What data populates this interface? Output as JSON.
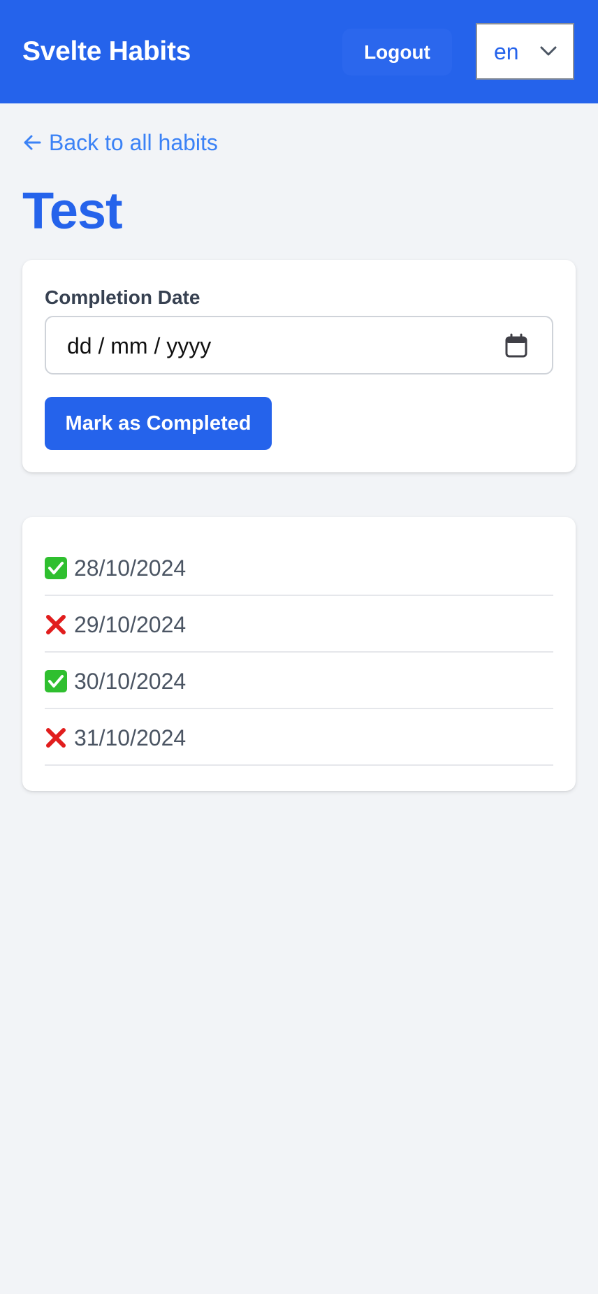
{
  "header": {
    "brand": "Svelte Habits",
    "logout_label": "Logout",
    "language": {
      "selected": "en",
      "icon": "chevron-down-icon"
    }
  },
  "nav": {
    "back_label": "Back to all habits",
    "back_icon": "arrow-left-icon"
  },
  "habit": {
    "title": "Test"
  },
  "form": {
    "date_label": "Completion Date",
    "date_placeholder": "dd / mm / yyyy",
    "date_icon": "calendar-icon",
    "submit_label": "Mark as Completed"
  },
  "completions": [
    {
      "status": "completed",
      "icon": "check-mark-icon",
      "date": "28/10/2024"
    },
    {
      "status": "not-completed",
      "icon": "cross-mark-icon",
      "date": "29/10/2024"
    },
    {
      "status": "completed",
      "icon": "check-mark-icon",
      "date": "30/10/2024"
    },
    {
      "status": "not-completed",
      "icon": "cross-mark-icon",
      "date": "31/10/2024"
    }
  ],
  "colors": {
    "primary": "#2563eb",
    "link": "#3b82f6",
    "background": "#f2f4f7",
    "check": "#2fbf2f",
    "cross": "#e11d1d"
  }
}
